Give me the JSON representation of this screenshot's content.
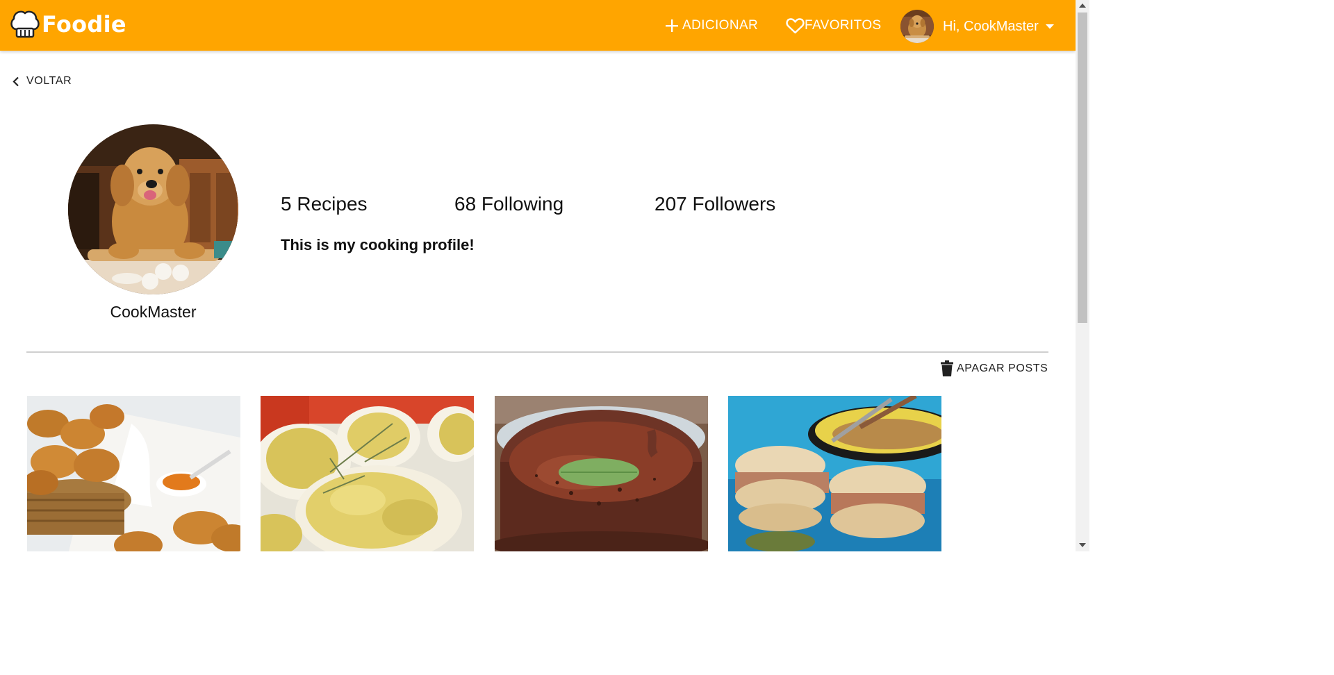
{
  "brand": {
    "name": "Foodie",
    "color": "#ffa500"
  },
  "header": {
    "add_label": "ADICIONAR",
    "add_icon": "plus-icon",
    "favorites_label": "FAVORITOS",
    "favorites_icon": "heart-outline-icon",
    "greeting": "Hi, CookMaster",
    "menu_icon": "caret-down-icon"
  },
  "navigation": {
    "back_label": "VOLTAR",
    "back_icon": "chevron-left-icon"
  },
  "profile": {
    "username": "CookMaster",
    "recipes": "5 Recipes",
    "following": "68 Following",
    "followers": "207 Followers",
    "bio": "This is my cooking profile!"
  },
  "actions": {
    "delete_posts_label": "APAGAR POSTS",
    "delete_icon": "trash-icon"
  },
  "posts": [
    {
      "image": "croissants-basket-photo"
    },
    {
      "image": "deviled-eggs-photo"
    },
    {
      "image": "chocolate-mousse-photo"
    },
    {
      "image": "pork-sandwich-photo"
    }
  ]
}
